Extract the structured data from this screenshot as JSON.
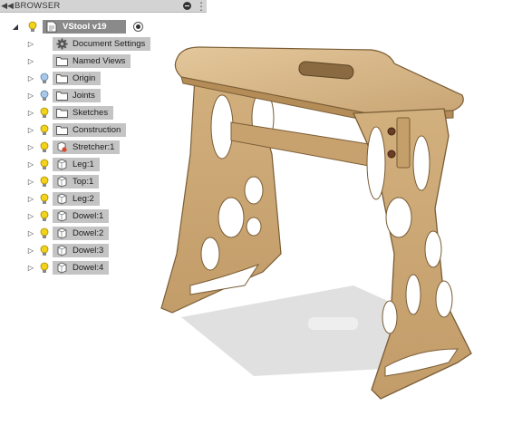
{
  "browser": {
    "title": "BROWSER",
    "collapse_icon": "double-chevron-left-icon",
    "root": {
      "label": "VStool v19",
      "active": true
    },
    "items": [
      {
        "label": "Document Settings",
        "icon": "gear-icon",
        "bulb": false
      },
      {
        "label": "Named Views",
        "icon": "folder-icon",
        "bulb": false
      },
      {
        "label": "Origin",
        "icon": "folder-icon",
        "bulb": "off"
      },
      {
        "label": "Joints",
        "icon": "folder-icon",
        "bulb": "off"
      },
      {
        "label": "Sketches",
        "icon": "folder-icon",
        "bulb": "on"
      },
      {
        "label": "Construction",
        "icon": "folder-icon",
        "bulb": "on"
      },
      {
        "label": "Stretcher:1",
        "icon": "component-link-icon",
        "bulb": "on"
      },
      {
        "label": "Leg:1",
        "icon": "component-icon",
        "bulb": "on"
      },
      {
        "label": "Top:1",
        "icon": "component-icon",
        "bulb": "on"
      },
      {
        "label": "Leg:2",
        "icon": "component-icon",
        "bulb": "on"
      },
      {
        "label": "Dowel:1",
        "icon": "component-icon",
        "bulb": "on"
      },
      {
        "label": "Dowel:2",
        "icon": "component-icon",
        "bulb": "on"
      },
      {
        "label": "Dowel:3",
        "icon": "component-icon",
        "bulb": "on"
      },
      {
        "label": "Dowel:4",
        "icon": "component-icon",
        "bulb": "on"
      }
    ]
  },
  "viewport": {
    "model": "stool-3d-model",
    "wood_color": "#d8b98a",
    "edge_color": "#7a5d35"
  }
}
